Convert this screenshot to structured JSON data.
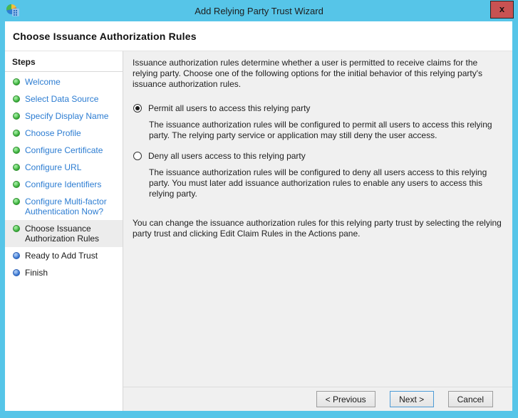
{
  "window": {
    "title": "Add Relying Party Trust Wizard",
    "close_label": "x"
  },
  "header": {
    "title": "Choose Issuance Authorization Rules"
  },
  "sidebar": {
    "title": "Steps",
    "items": [
      {
        "label": "Welcome",
        "state": "done"
      },
      {
        "label": "Select Data Source",
        "state": "done"
      },
      {
        "label": "Specify Display Name",
        "state": "done"
      },
      {
        "label": "Choose Profile",
        "state": "done"
      },
      {
        "label": "Configure Certificate",
        "state": "done"
      },
      {
        "label": "Configure URL",
        "state": "done"
      },
      {
        "label": "Configure Identifiers",
        "state": "done"
      },
      {
        "label": "Configure Multi-factor Authentication Now?",
        "state": "done"
      },
      {
        "label": "Choose Issuance Authorization Rules",
        "state": "current"
      },
      {
        "label": "Ready to Add Trust",
        "state": "upcoming"
      },
      {
        "label": "Finish",
        "state": "upcoming"
      }
    ]
  },
  "content": {
    "intro": "Issuance authorization rules determine whether a user is permitted to receive claims for the relying party. Choose one of the following options for the initial behavior of this relying party's issuance authorization rules.",
    "options": [
      {
        "label": "Permit all users to access this relying party",
        "selected": true,
        "description": "The issuance authorization rules will be configured to permit all users to access this relying party. The relying party service or application may still deny the user access."
      },
      {
        "label": "Deny all users access to this relying party",
        "selected": false,
        "description": "The issuance authorization rules will be configured to deny all users access to this relying party. You must later add issuance authorization rules to enable any users to access this relying party."
      }
    ],
    "footnote": "You can change the issuance authorization rules for this relying party trust by selecting the relying party trust and clicking Edit Claim Rules in the Actions pane."
  },
  "buttons": {
    "previous": "< Previous",
    "next": "Next >",
    "cancel": "Cancel"
  },
  "colors": {
    "frame_blue": "#56C5E8",
    "close_red": "#C85252",
    "link_blue": "#2D7DD2",
    "bullet_green": "#3CB03C",
    "bullet_blue": "#3A77D2",
    "content_bg": "#F0F0F0"
  }
}
